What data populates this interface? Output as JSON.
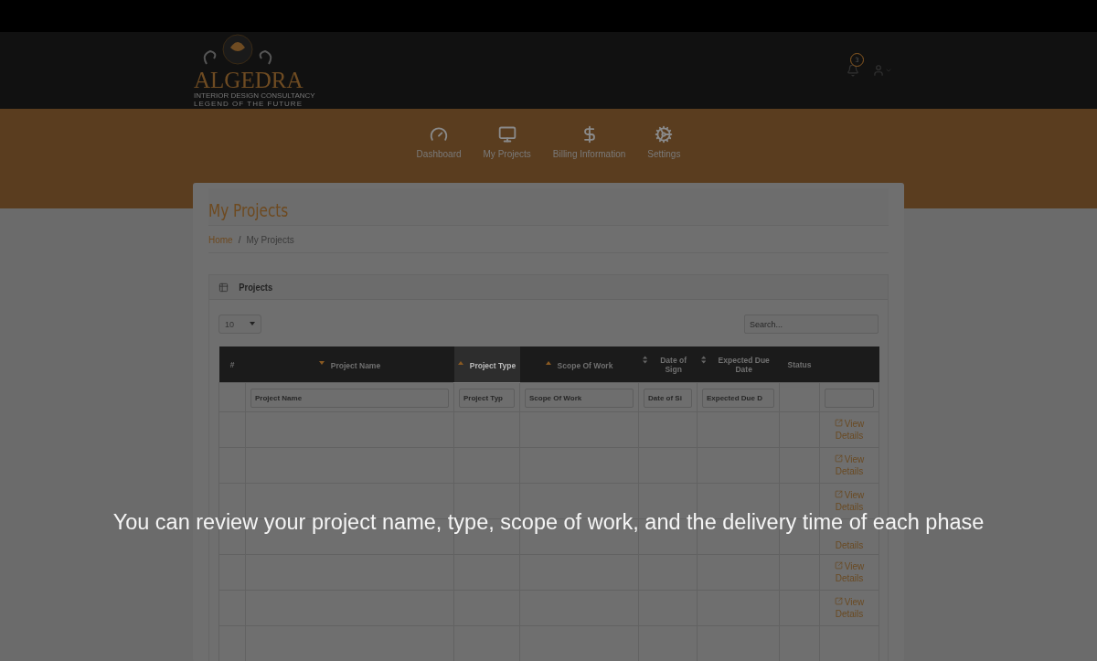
{
  "logo": {
    "name": "ALGEDRA",
    "tagline": "INTERIOR DESIGN CONSULTANCY",
    "motto": "LEGEND OF THE FUTURE"
  },
  "notifications": {
    "count": "3"
  },
  "nav": [
    {
      "label": "Dashboard",
      "kind": "gauge"
    },
    {
      "label": "My Projects",
      "kind": "monitor"
    },
    {
      "label": "Billing Information",
      "kind": "dollar"
    },
    {
      "label": "Settings",
      "kind": "gears"
    }
  ],
  "page_title": "My Projects",
  "breadcrumb_separator": "/",
  "breadcrumb": [
    {
      "label": "Home",
      "kind": "link"
    },
    {
      "label": "My Projects",
      "kind": "current"
    }
  ],
  "panel": {
    "title": "Projects",
    "page_size": "10",
    "search": {
      "placeholder": "Search..."
    },
    "columns": [
      {
        "label": "#",
        "kind": "plain",
        "selected": false
      },
      {
        "label": "Project Name",
        "kind": "desc",
        "selected": false
      },
      {
        "label": "Project Type",
        "kind": "asc",
        "selected": true
      },
      {
        "label": "Scope Of Work",
        "kind": "asc",
        "selected": false
      },
      {
        "label": "Date of Sign",
        "kind": "sortable",
        "selected": false
      },
      {
        "label": "Expected Due Date",
        "kind": "sortable",
        "selected": false
      },
      {
        "label": "Status",
        "kind": "plain",
        "selected": false
      },
      {
        "kind": "plain",
        "selected": false
      }
    ],
    "filters": [
      {
        "kind": "none"
      },
      {
        "kind": "input",
        "placeholder": "Project Name"
      },
      {
        "kind": "input",
        "placeholder": "Project Typ"
      },
      {
        "kind": "input",
        "placeholder": "Scope Of Work"
      },
      {
        "kind": "input",
        "placeholder": "Date of Si"
      },
      {
        "kind": "input",
        "placeholder": "Expected Due D"
      },
      {
        "kind": "none"
      },
      {
        "kind": "input"
      }
    ],
    "rows": [
      {
        "link": "View Details",
        "icon": true
      },
      {
        "link": "View Details",
        "icon": true
      },
      {
        "link": "View Details",
        "icon": true
      },
      {
        "link": "Details",
        "icon": false
      },
      {
        "link": "View Details",
        "icon": true
      },
      {
        "link": "View Details",
        "icon": true
      }
    ]
  },
  "caption": "You can review your project name, type, scope of work, and the delivery time of each phase"
}
